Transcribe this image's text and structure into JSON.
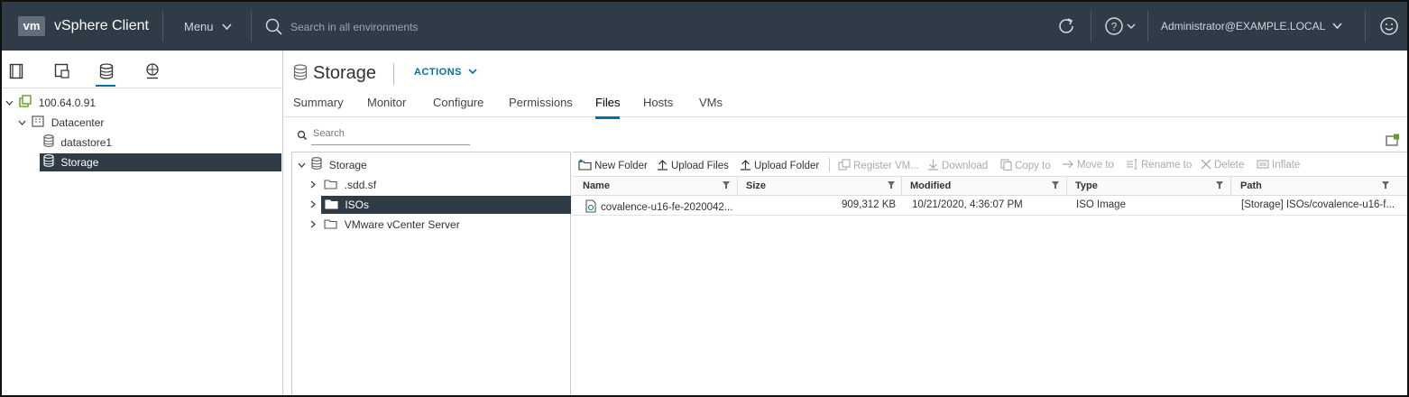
{
  "header": {
    "logo": "vm",
    "app_title": "vSphere Client",
    "menu_label": "Menu",
    "search_placeholder": "Search in all environments",
    "user": "Administrator@EXAMPLE.LOCAL",
    "icons": [
      "refresh-icon",
      "help-icon",
      "user-feedback-icon"
    ]
  },
  "navigator": {
    "icons": [
      "hosts-clusters-icon",
      "vms-templates-icon",
      "storage-icon",
      "networking-icon"
    ],
    "active_icon": "storage-icon",
    "tree": [
      {
        "label": "100.64.0.91",
        "icon": "vcenter-icon",
        "expanded": true,
        "level": 0
      },
      {
        "label": "Datacenter",
        "icon": "datacenter-icon",
        "expanded": true,
        "level": 1
      },
      {
        "label": "datastore1",
        "icon": "datastore-icon",
        "level": 2
      },
      {
        "label": "Storage",
        "icon": "datastore-icon",
        "level": 2,
        "selected": true
      }
    ]
  },
  "object": {
    "title": "Storage",
    "actions_label": "ACTIONS"
  },
  "tabs": [
    {
      "label": "Summary"
    },
    {
      "label": "Monitor"
    },
    {
      "label": "Configure"
    },
    {
      "label": "Permissions"
    },
    {
      "label": "Files",
      "active": true
    },
    {
      "label": "Hosts"
    },
    {
      "label": "VMs"
    }
  ],
  "files_search_placeholder": "Search",
  "folder_tree": [
    {
      "label": "Storage",
      "expanded": true,
      "level": 0
    },
    {
      "label": ".sdd.sf",
      "level": 1
    },
    {
      "label": "ISOs",
      "level": 1,
      "selected": true
    },
    {
      "label": "VMware vCenter Server",
      "level": 1
    }
  ],
  "toolbar": {
    "new_folder": "New Folder",
    "upload_files": "Upload Files",
    "upload_folder": "Upload Folder",
    "register_vm": "Register VM...",
    "download": "Download",
    "copy_to": "Copy to",
    "move_to": "Move to",
    "rename_to": "Rename to",
    "delete": "Delete",
    "inflate": "Inflate"
  },
  "table": {
    "columns": [
      "Name",
      "Size",
      "Modified",
      "Type",
      "Path"
    ],
    "rows": [
      {
        "name": "covalence-u16-fe-2020042...",
        "size": "909,312 KB",
        "modified": "10/21/2020, 4:36:07 PM",
        "type": "ISO Image",
        "path": "[Storage] ISOs/covalence-u16-f..."
      }
    ]
  },
  "colors": {
    "header_bg": "#2f3b46",
    "accent": "#0072a3",
    "selected_bg": "#2f3b46"
  }
}
